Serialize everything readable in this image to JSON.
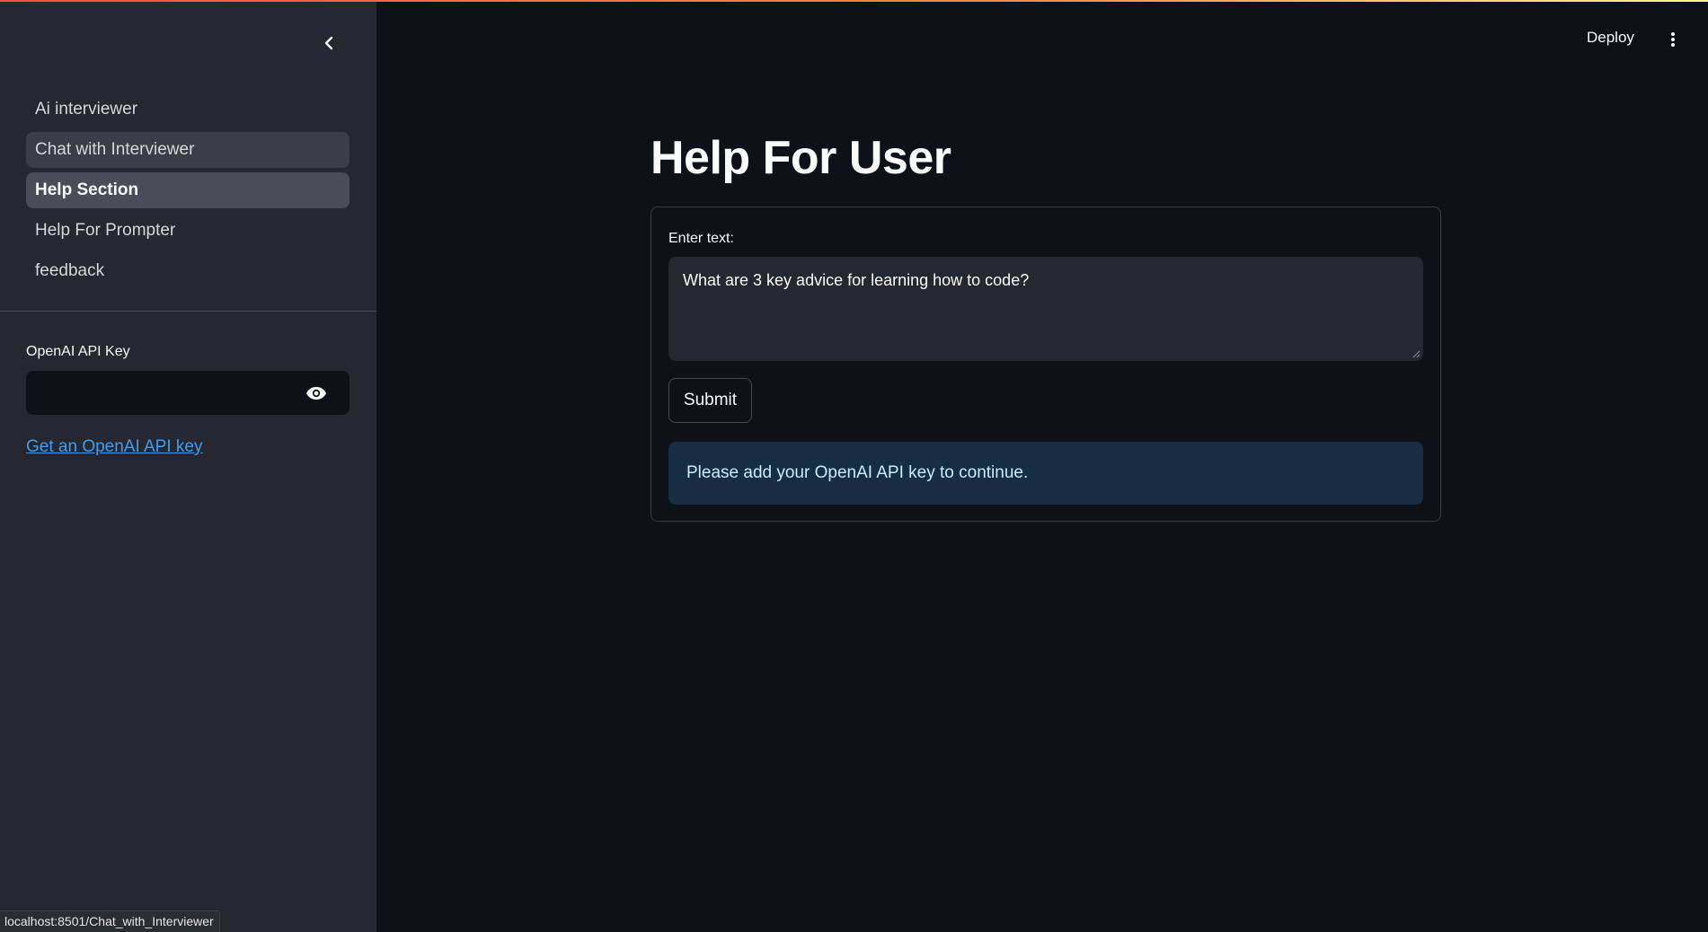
{
  "sidebar": {
    "collapse_icon": "chevron-left-icon",
    "nav_items": [
      {
        "label": "Ai interviewer",
        "state": "normal"
      },
      {
        "label": "Chat with Interviewer",
        "state": "hover"
      },
      {
        "label": "Help Section",
        "state": "active"
      },
      {
        "label": "Help For Prompter",
        "state": "normal"
      },
      {
        "label": "feedback",
        "state": "normal"
      }
    ],
    "api_key": {
      "label": "OpenAI API Key",
      "value": "",
      "toggle_icon": "eye-icon"
    },
    "link_text": "Get an OpenAI API key"
  },
  "header": {
    "deploy_label": "Deploy",
    "menu_icon": "more-vertical-icon"
  },
  "main": {
    "title": "Help For User",
    "form": {
      "input_label": "Enter text:",
      "input_value": "What are 3 key advice for learning how to code?",
      "submit_label": "Submit",
      "info_message": "Please add your OpenAI API key to continue."
    }
  },
  "status_bar": {
    "url": "localhost:8501/Chat_with_Interviewer"
  },
  "colors": {
    "app_bg": "#0e1117",
    "sidebar_bg": "#262730",
    "link": "#3d9df6",
    "info_bg": "#172d43",
    "info_text": "#c7ebff"
  }
}
